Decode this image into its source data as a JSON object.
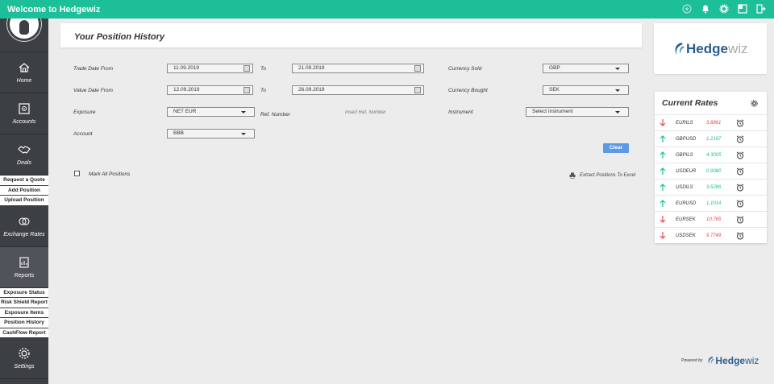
{
  "app": {
    "title": "Welcome to Hedgewiz"
  },
  "topbar_icons": [
    "plus-circle-icon",
    "bell-icon",
    "gear-icon",
    "window-icon",
    "logout-icon"
  ],
  "sidebar": {
    "nav": [
      {
        "label": "Home",
        "icon": "home-icon"
      },
      {
        "label": "Accounts",
        "icon": "safe-icon"
      },
      {
        "label": "Deals",
        "icon": "handshake-icon"
      }
    ],
    "deals_sub": [
      "Request a Quote",
      "Add Position",
      "Upload Position"
    ],
    "exchange": {
      "label": "Exchange Rates",
      "icon": "exchange-icon"
    },
    "reports": {
      "label": "Reports",
      "icon": "reports-icon"
    },
    "reports_sub": [
      "Exposure Status",
      "Risk Shield Report",
      "Exposure Items",
      "Position History",
      "CashFlow Report"
    ],
    "settings": {
      "label": "Settings",
      "icon": "gear-icon"
    }
  },
  "page": {
    "title": "Your Position History"
  },
  "form": {
    "trade_date_from_label": "Trade Date From",
    "trade_date_from": "11.09.2019",
    "trade_to_label": "To",
    "trade_date_to": "21.09.2019",
    "currency_sold_label": "Currency Sold",
    "currency_sold": "GBP",
    "value_date_from_label": "Value Date From",
    "value_date_from": "12.09.2019",
    "value_to_label": "To",
    "value_date_to": "26.09.2019",
    "currency_bought_label": "Currency Bought",
    "currency_bought": "SEK",
    "exposure_label": "Exposure",
    "exposure": "NET EUR",
    "ref_label": "Ref. Number",
    "ref_placeholder": "Insert Ref. Number",
    "instrument_label": "Instrument",
    "instrument": "Select Instrument",
    "account_label": "Account",
    "account": "BBB",
    "clear_label": "Clear",
    "mark_all_label": "Mark All Positions",
    "export_label": "Extract Positions To Excel"
  },
  "logo": {
    "part1": "Hedge",
    "part2": "wiz"
  },
  "rates": {
    "title": "Current Rates",
    "items": [
      {
        "pair": "EURILS",
        "value": "3.8861",
        "dir": "down"
      },
      {
        "pair": "GBPUSD",
        "value": "1.2187",
        "dir": "up"
      },
      {
        "pair": "GBPILS",
        "value": "4.3005",
        "dir": "up"
      },
      {
        "pair": "USDEUR",
        "value": "0.9080",
        "dir": "up"
      },
      {
        "pair": "USDILS",
        "value": "3.5286",
        "dir": "up"
      },
      {
        "pair": "EURUSD",
        "value": "1.1014",
        "dir": "up"
      },
      {
        "pair": "EURSEK",
        "value": "10.765",
        "dir": "down"
      },
      {
        "pair": "USDSEK",
        "value": "9.7749",
        "dir": "down"
      }
    ],
    "colors": {
      "up": "#1dbf98",
      "down": "#e8474c"
    }
  },
  "powered": {
    "label": "Powered by",
    "part1": "Hedge",
    "part2": "wiz"
  }
}
